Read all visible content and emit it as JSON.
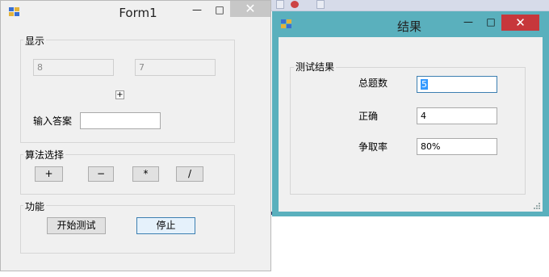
{
  "form1": {
    "title": "Form1",
    "minimize_glyph": "—",
    "maximize_glyph": "□",
    "close_glyph": "✕",
    "display_group": {
      "label": "显示",
      "operand1": "8",
      "operand2": "7",
      "operator": "+",
      "answer_label": "输入答案",
      "answer_value": ""
    },
    "algorithm_group": {
      "label": "算法选择",
      "buttons": [
        "+",
        "−",
        "*",
        "/"
      ]
    },
    "function_group": {
      "label": "功能",
      "start_label": "开始测试",
      "stop_label": "停止"
    }
  },
  "result": {
    "title": "结果",
    "minimize_glyph": "—",
    "maximize_glyph": "□",
    "close_glyph": "✕",
    "group_label": "测试结果",
    "rows": [
      {
        "label": "总题数",
        "value": "5"
      },
      {
        "label": "正确",
        "value": "4"
      },
      {
        "label": "争取率",
        "value": "80%"
      }
    ]
  },
  "colors": {
    "window_bg": "#f0f0f0",
    "result_frame": "#5ab0bd",
    "close_active": "#c7373b",
    "selection": "#3399ff"
  }
}
